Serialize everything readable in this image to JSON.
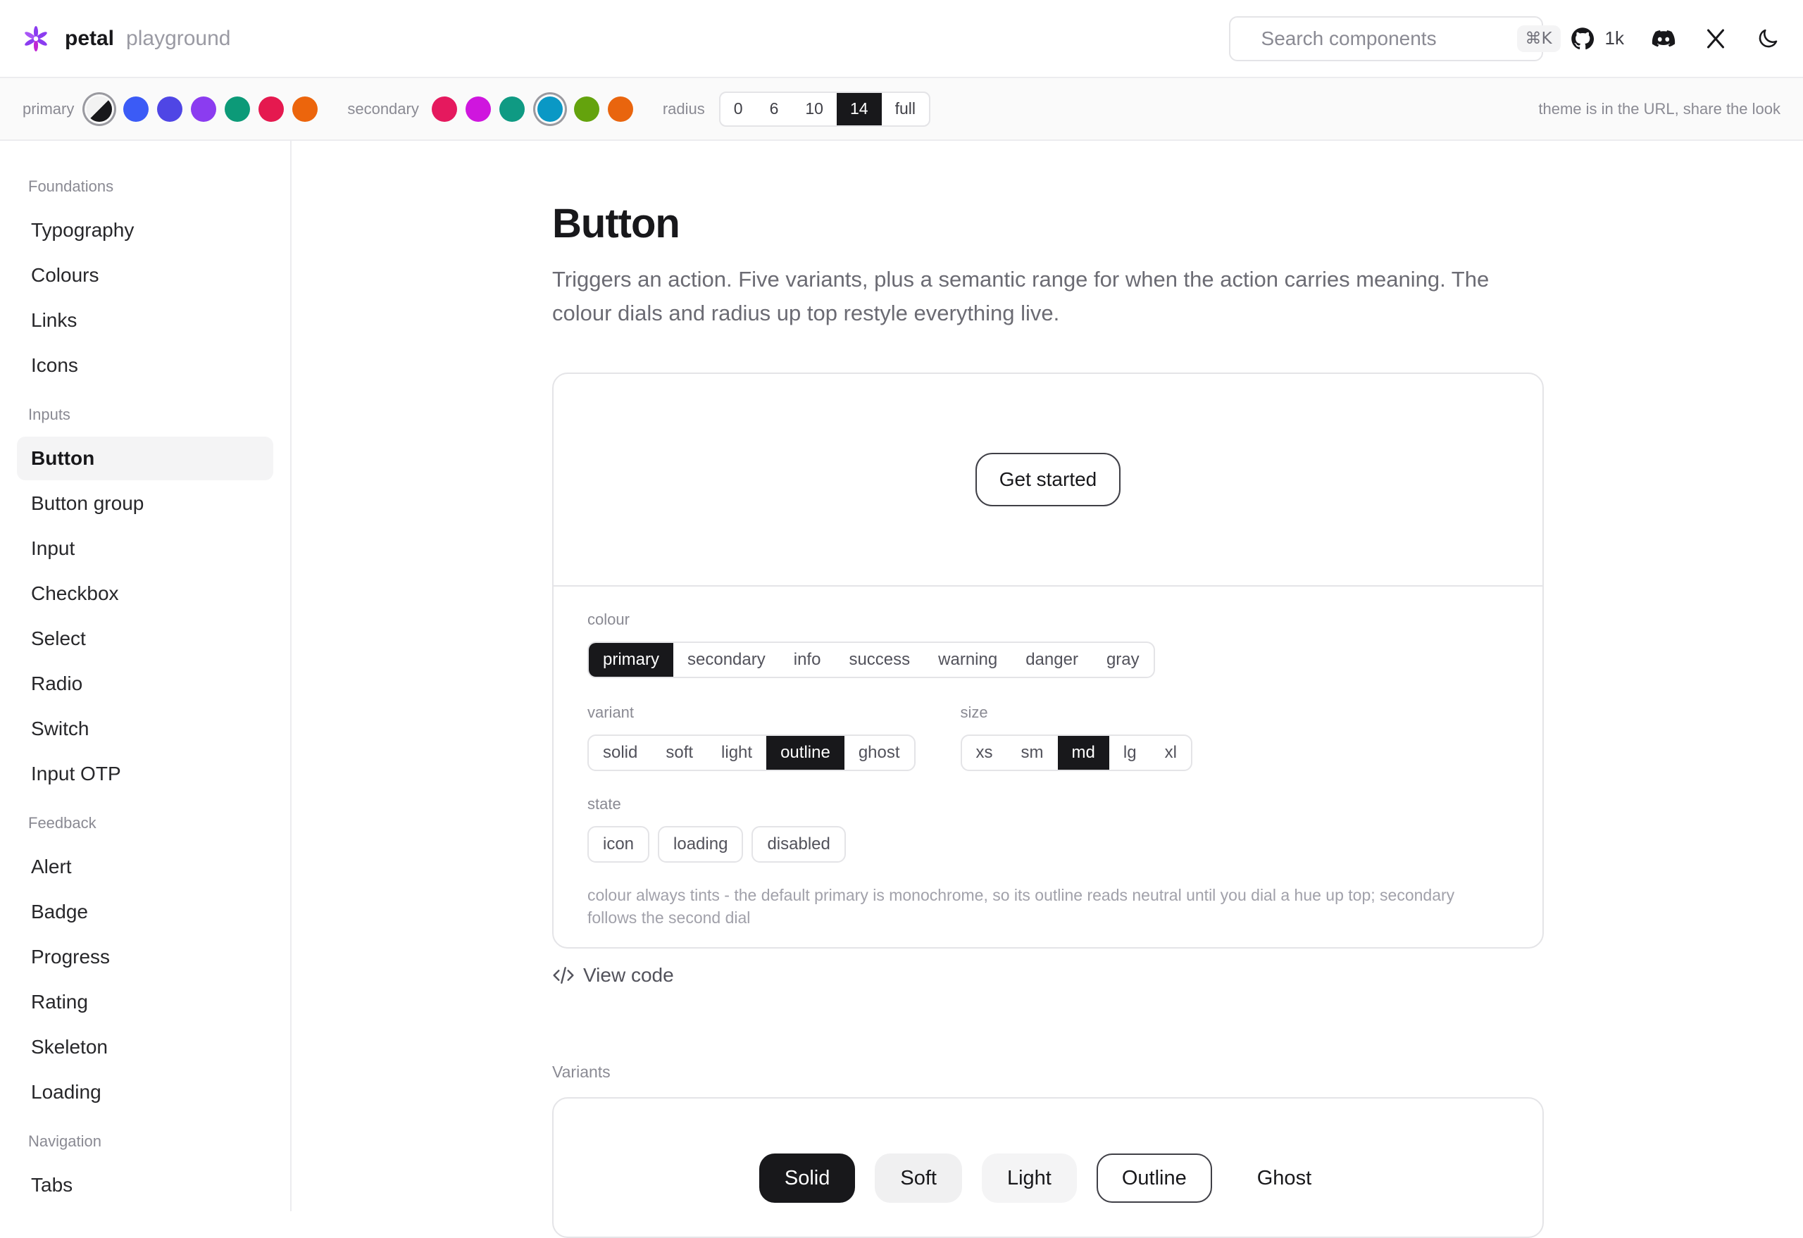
{
  "header": {
    "brand": "petal",
    "brand_sub": "playground",
    "search_placeholder": "Search components",
    "search_shortcut": "⌘K",
    "github_stars": "1k"
  },
  "theme": {
    "primary_label": "primary",
    "primary_colors": [
      "#3b5bf6",
      "#4f46e5",
      "#8b3cf0",
      "#0c9a78",
      "#e5194f",
      "#ec650c"
    ],
    "secondary_label": "secondary",
    "secondary_colors": [
      "#e5195e",
      "#cf16de",
      "#0f9a83",
      "#0a98c5",
      "#64a30d",
      "#e9650e"
    ],
    "radius_label": "radius",
    "radius_options": [
      "0",
      "6",
      "10",
      "14",
      "full"
    ],
    "radius_selected": "14",
    "share_text": "theme is in the URL, share the look"
  },
  "sidebar": {
    "sections": [
      {
        "title": "Foundations",
        "items": [
          "Typography",
          "Colours",
          "Links",
          "Icons"
        ]
      },
      {
        "title": "Inputs",
        "items": [
          "Button",
          "Button group",
          "Input",
          "Checkbox",
          "Select",
          "Radio",
          "Switch",
          "Input OTP"
        ]
      },
      {
        "title": "Feedback",
        "items": [
          "Alert",
          "Badge",
          "Progress",
          "Rating",
          "Skeleton",
          "Loading"
        ]
      },
      {
        "title": "Navigation",
        "items": [
          "Tabs"
        ]
      }
    ],
    "active": "Button"
  },
  "main": {
    "title": "Button",
    "description": "Triggers an action. Five variants, plus a semantic range for when the action carries meaning. The colour dials and radius up top restyle everything live.",
    "demo_button": "Get started",
    "colour_label": "colour",
    "colour_options": [
      "primary",
      "secondary",
      "info",
      "success",
      "warning",
      "danger",
      "gray"
    ],
    "colour_selected": "primary",
    "variant_label": "variant",
    "variant_options": [
      "solid",
      "soft",
      "light",
      "outline",
      "ghost"
    ],
    "variant_selected": "outline",
    "size_label": "size",
    "size_options": [
      "xs",
      "sm",
      "md",
      "lg",
      "xl"
    ],
    "size_selected": "md",
    "state_label": "state",
    "state_options": [
      "icon",
      "loading",
      "disabled"
    ],
    "note": "colour always tints - the default primary is monochrome, so its outline reads neutral until you dial a hue up top; secondary follows the second dial",
    "view_code": "View code",
    "variants_heading": "Variants",
    "variant_buttons": [
      "Solid",
      "Soft",
      "Light",
      "Outline",
      "Ghost"
    ]
  }
}
